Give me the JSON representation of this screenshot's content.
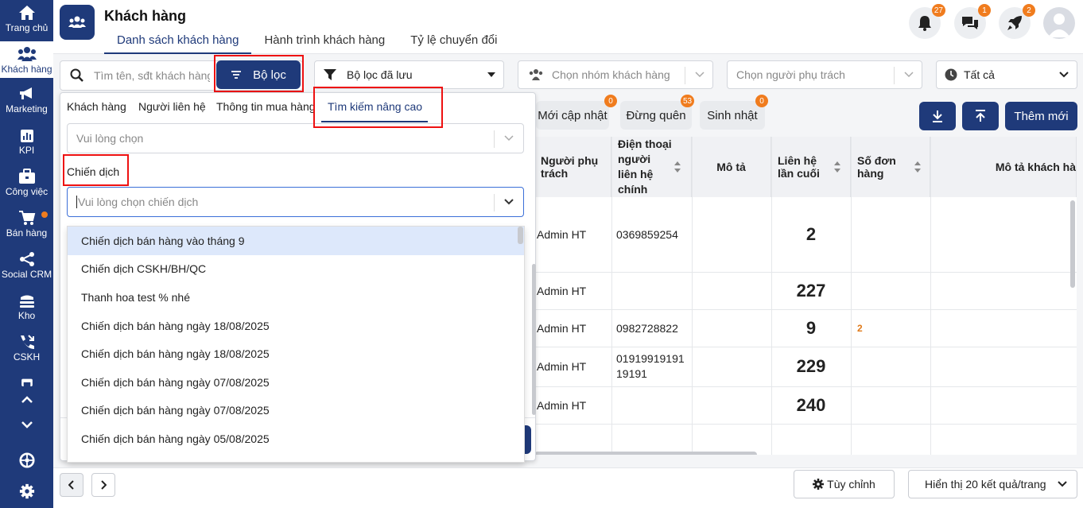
{
  "sidebar": {
    "items": [
      {
        "label": "Trang chủ",
        "icon": "home-icon"
      },
      {
        "label": "Khách hàng",
        "icon": "users-icon"
      },
      {
        "label": "Marketing",
        "icon": "megaphone-icon"
      },
      {
        "label": "KPI",
        "icon": "chart-icon"
      },
      {
        "label": "Công việc",
        "icon": "briefcase-icon"
      },
      {
        "label": "Bán hàng",
        "icon": "cart-icon"
      },
      {
        "label": "Social CRM",
        "icon": "share-icon"
      },
      {
        "label": "Kho",
        "icon": "warehouse-icon"
      },
      {
        "label": "CSKH",
        "icon": "phone-icon"
      }
    ]
  },
  "header": {
    "title": "Khách hàng",
    "tabs": [
      "Danh sách khách hàng",
      "Hành trình khách hàng",
      "Tỷ lệ chuyển đổi"
    ],
    "notifications": "27",
    "messages": "1",
    "rocket": "2"
  },
  "toolbar": {
    "search_placeholder": "Tìm tên, sđt khách hàng",
    "filter_label": "Bộ lọc",
    "saved_filter_label": "Bộ lọc đã lưu",
    "group_placeholder": "Chọn nhóm khách hàng",
    "owner_placeholder": "Chọn người phụ trách",
    "status_label": "Tất cả"
  },
  "quick_filters": [
    {
      "label": "Mới cập nhật",
      "count": "0"
    },
    {
      "label": "Đừng quên",
      "count": "53"
    },
    {
      "label": "Sinh nhật",
      "count": "0"
    }
  ],
  "add_new_label": "Thêm mới",
  "filter_panel": {
    "tabs": [
      "Khách hàng",
      "Người liên hệ",
      "Thông tin mua hàng",
      "Tìm kiếm nâng cao"
    ],
    "first_select_placeholder": "Vui lòng chọn",
    "campaign_label": "Chiến dịch",
    "campaign_placeholder": "Vui lòng chọn chiến dịch",
    "campaign_options": [
      "Chiến dịch bán hàng vào tháng 9",
      "Chiến dịch CSKH/BH/QC",
      "Thanh hoa test % nhé",
      "Chiến dịch bán hàng ngày 18/08/2025",
      "Chiến dịch bán hàng ngày 18/08/2025",
      "Chiến dịch bán hàng ngày 07/08/2025",
      "Chiến dịch bán hàng ngày 07/08/2025",
      "Chiến dịch bán hàng ngày 05/08/2025"
    ]
  },
  "table": {
    "headers": [
      "Người phụ trách",
      "Điện thoại người liên hệ chính",
      "Mô tả",
      "Liên hệ lần cuối",
      "Số đơn hàng",
      "Mô tả khách hà"
    ],
    "rows": [
      {
        "owner": "Admin HT",
        "phone": "0369859254",
        "last_contact": "2",
        "orders": ""
      },
      {
        "owner": "Admin HT",
        "phone": "",
        "last_contact": "227",
        "orders": ""
      },
      {
        "owner": "Admin HT",
        "phone": "0982728822",
        "last_contact": "9",
        "orders": "2"
      },
      {
        "owner": "Admin HT",
        "phone": "01919919191 19191",
        "last_contact": "229",
        "orders": ""
      },
      {
        "owner": "Admin HT",
        "phone": "",
        "last_contact": "240",
        "orders": ""
      }
    ]
  },
  "footer": {
    "customize_label": "Tùy chỉnh",
    "page_size_label": "Hiển thị 20 kết quả/trang"
  },
  "colors": {
    "primary": "#1f3a7a",
    "badge": "#f07c1e",
    "highlight": "#e11111"
  }
}
